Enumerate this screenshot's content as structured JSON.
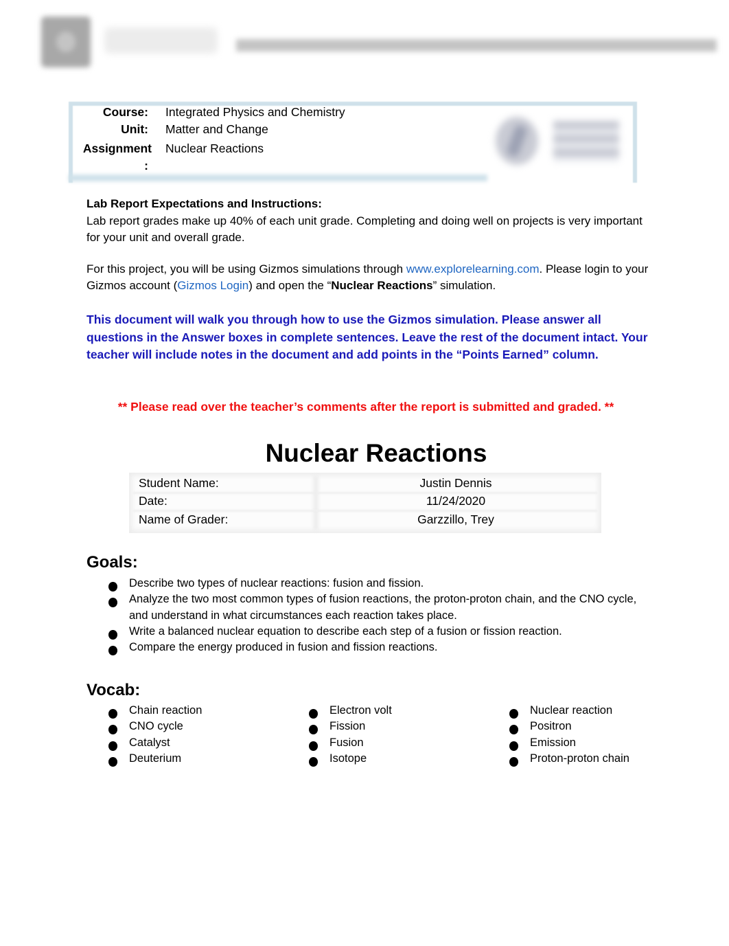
{
  "header": {
    "logo_icon": "gizmos-logo-icon",
    "wordmark": "Gizmos"
  },
  "course_info": {
    "rows": [
      {
        "label": "Course:",
        "value": "Integrated Physics and Chemistry"
      },
      {
        "label": "Unit:",
        "value": "Matter and Change"
      },
      {
        "label": "Assignment",
        "label_cont": ":",
        "value": "Nuclear Reactions"
      }
    ],
    "school_logo_icon": "school-logo-icon"
  },
  "instructions": {
    "heading": "Lab Report Expectations and Instructions:",
    "paragraph1": "Lab report grades make up 40% of each unit grade.  Completing and doing well on projects is very important for your unit and overall grade.",
    "paragraph2": {
      "part1": "For this project, you will be using Gizmos simulations through ",
      "link1": "www.explorelearning.com",
      "part2": ".  Please login to your Gizmos account (",
      "link2": "Gizmos Login",
      "part3": ") and open the “",
      "bold": "Nuclear Reactions",
      "part4": "” simulation."
    },
    "blue_note": "This document will walk you through how to use the Gizmos simulation.  Please answer all questions in the Answer boxes in complete sentences.  Leave the rest of the document intact. Your teacher will include notes in the document and add points in the “Points Earned” column.",
    "red_note": "** Please read over the teacher’s comments after the report is submitted and graded. **"
  },
  "title": "Nuclear Reactions",
  "student_info": [
    {
      "label": "Student Name:",
      "value": "Justin Dennis"
    },
    {
      "label": "Date:",
      "value": "11/24/2020"
    },
    {
      "label": "Name of Grader:",
      "value": "Garzzillo, Trey"
    }
  ],
  "goals": {
    "heading": "Goals:",
    "items": [
      "Describe two types of nuclear reactions: fusion and fission.",
      "Analyze the two most common types of fusion reactions, the proton-proton chain, and the CNO cycle, and understand in what circumstances each reaction takes place.",
      "Write a balanced nuclear equation to describe each step of a fusion or fission reaction.",
      "Compare the energy produced in fusion and fission reactions."
    ]
  },
  "vocab": {
    "heading": "Vocab:",
    "columns": [
      [
        "Chain reaction",
        "CNO cycle",
        "Catalyst",
        "Deuterium"
      ],
      [
        "Electron volt",
        "Fission",
        "Fusion",
        "Isotope"
      ],
      [
        "Nuclear reaction",
        "Positron",
        "Emission",
        "Proton-proton chain"
      ]
    ]
  },
  "colors": {
    "link": "#1f66c2",
    "blue_note": "#1a1ab8",
    "red_note": "#f01010",
    "panel_border": "#cfe1ea"
  }
}
